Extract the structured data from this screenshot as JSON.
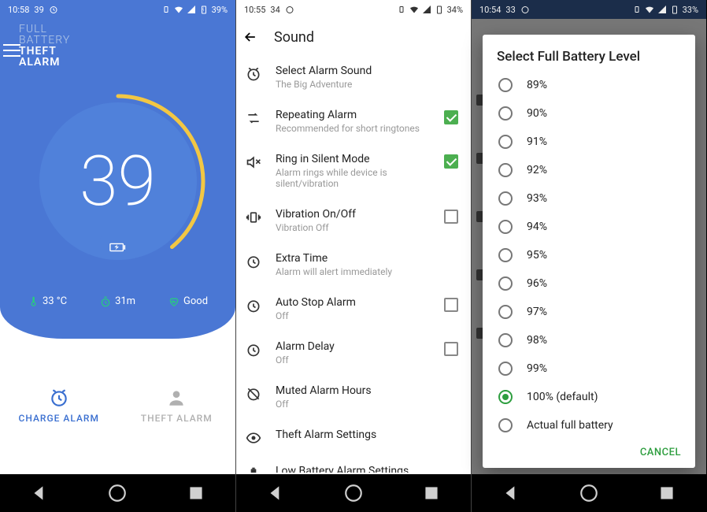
{
  "pane1": {
    "status": {
      "time": "10:58",
      "small": "39",
      "battery": "39%"
    },
    "brand": {
      "l1": "FULL",
      "l2": "BATTERY",
      "l3": "THEFT",
      "l4": "ALARM"
    },
    "battery_pct": "39",
    "stats": {
      "temp": "33 °C",
      "time": "31m",
      "health": "Good"
    },
    "tabs": {
      "charge": "CHARGE ALARM",
      "theft": "THEFT ALARM"
    }
  },
  "pane2": {
    "status": {
      "time": "10:55",
      "small": "34",
      "battery": "34%"
    },
    "title": "Sound",
    "items": [
      {
        "icon": "alarm-clock-icon",
        "title": "Select Alarm Sound",
        "sub": "The Big Adventure",
        "ctl": "none"
      },
      {
        "icon": "repeat-icon",
        "title": "Repeating Alarm",
        "sub": "Recommended for short ringtones",
        "ctl": "check-on"
      },
      {
        "icon": "mute-icon",
        "title": "Ring in Silent Mode",
        "sub": "Alarm rings while device is silent/vibration",
        "ctl": "check-on"
      },
      {
        "icon": "vibration-icon",
        "title": "Vibration On/Off",
        "sub": "Vibration Off",
        "ctl": "check-off"
      },
      {
        "icon": "timer-icon",
        "title": "Extra Time",
        "sub": "Alarm will alert immediately",
        "ctl": "none"
      },
      {
        "icon": "timer-icon",
        "title": "Auto Stop Alarm",
        "sub": "Off",
        "ctl": "check-off"
      },
      {
        "icon": "timer-icon",
        "title": "Alarm Delay",
        "sub": "Off",
        "ctl": "check-off"
      },
      {
        "icon": "no-alarm-icon",
        "title": "Muted Alarm Hours",
        "sub": "Off",
        "ctl": "none"
      },
      {
        "icon": "eye-icon",
        "title": "Theft Alarm Settings",
        "sub": "",
        "ctl": "none"
      },
      {
        "icon": "battery-icon",
        "title": "Low Battery Alarm Settings",
        "sub": "",
        "ctl": "none"
      }
    ]
  },
  "pane3": {
    "status": {
      "time": "10:54",
      "small": "33",
      "battery": "33%"
    },
    "dialog": {
      "title": "Select Full Battery Level",
      "options": [
        {
          "label": "89%",
          "selected": false
        },
        {
          "label": "90%",
          "selected": false
        },
        {
          "label": "91%",
          "selected": false
        },
        {
          "label": "92%",
          "selected": false
        },
        {
          "label": "93%",
          "selected": false
        },
        {
          "label": "94%",
          "selected": false
        },
        {
          "label": "95%",
          "selected": false
        },
        {
          "label": "96%",
          "selected": false
        },
        {
          "label": "97%",
          "selected": false
        },
        {
          "label": "98%",
          "selected": false
        },
        {
          "label": "99%",
          "selected": false
        },
        {
          "label": "100% (default)",
          "selected": true
        },
        {
          "label": "Actual full battery",
          "selected": false
        }
      ],
      "cancel": "CANCEL"
    }
  }
}
